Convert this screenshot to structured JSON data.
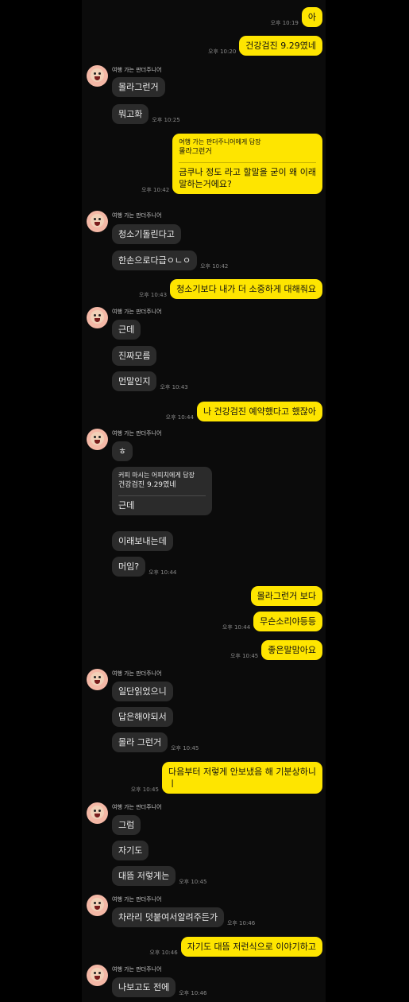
{
  "sender_name": "여행 가는 판더주니어",
  "messages": [
    {
      "text": "아",
      "time": "오후 10:19"
    },
    {
      "text": "건강검진 9.29였네",
      "time": "오후 10:20"
    },
    {
      "text": "몰라그런거"
    },
    {
      "text": "뭐고화",
      "time": "오후 10:25"
    },
    {
      "reply_to": "여행 가는 판더주니어에게 답장",
      "quote": "몰라그런거",
      "text": "금쿠나 정도 라고 할말을 굳이 왜 이래",
      "text2": "말하는거에요?",
      "time": "오후 10:42"
    },
    {
      "text": "청소기돌린다고"
    },
    {
      "text": "한손으로다급ㅇㄴㅇ",
      "time": "오후 10:42"
    },
    {
      "text": "청소기보다 내가 더 소중하게 대해줘요",
      "time": "오후 10:43"
    },
    {
      "text": "근데"
    },
    {
      "text": "진짜모름"
    },
    {
      "text": "먼말인지",
      "time": "오후 10:43"
    },
    {
      "text": "나 건강검진 예약했다고 했잖아",
      "time": "오후 10:44"
    },
    {
      "text": "ㅎ"
    },
    {
      "reply_to": "커피 마시는 어피치에게 답장",
      "quote": "건강검진 9.29였네",
      "text": "근데"
    },
    {
      "text": "이래보내는데"
    },
    {
      "text": "머임?",
      "time": "오후 10:44"
    },
    {
      "text": "몰라그런거 보다"
    },
    {
      "text": "무슨소리야등등",
      "time": "오후 10:44"
    },
    {
      "text": "좋은말맘아요",
      "time": "오후 10:45"
    },
    {
      "text": "일단읽었으니"
    },
    {
      "text": "답은해야되서"
    },
    {
      "text": "몰라 그런거",
      "time": "오후 10:45"
    },
    {
      "text": "다음부터 저렇게 안보냈음 해 기분상하니",
      "text2": "ㅣ",
      "time": "오후 10:45"
    },
    {
      "text": "그럼"
    },
    {
      "text": "자기도"
    },
    {
      "text": "대뜸 저렇게는",
      "time": "오후 10:45"
    },
    {
      "text": "차라리 덧붙여서알려주든가",
      "time": "오후 10:46"
    },
    {
      "text": "자기도 대뜸 저런식으로 이야기하고",
      "time": "오후 10:46"
    },
    {
      "text": "나보고도 전에",
      "time": "오후 10:46"
    }
  ]
}
